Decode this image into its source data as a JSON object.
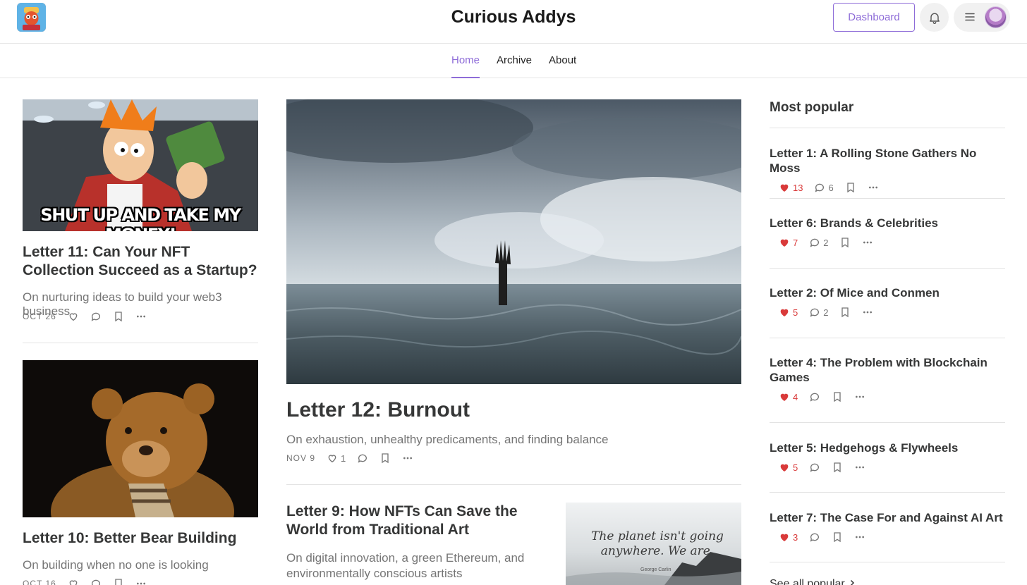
{
  "header": {
    "site_title": "Curious Addys",
    "dashboard_label": "Dashboard",
    "bell_icon": "bell-icon",
    "menu_icon": "hamburger-icon"
  },
  "nav": {
    "tabs": [
      {
        "label": "Home",
        "active": true
      },
      {
        "label": "Archive",
        "active": false
      },
      {
        "label": "About",
        "active": false
      }
    ]
  },
  "posts": {
    "letter11": {
      "image_caption": "SHUT UP AND TAKE MY MONEY!",
      "title": "Letter 11: Can Your NFT Collection Succeed as a Startup?",
      "subtitle": "On nurturing ideas to build your web3 business",
      "date": "OCT 26"
    },
    "letter10": {
      "title": "Letter 10: Better Bear Building",
      "subtitle": "On building when no one is looking",
      "date": "OCT 16"
    },
    "letter12": {
      "title": "Letter 12: Burnout",
      "subtitle": "On exhaustion, unhealthy predicaments, and finding balance",
      "date": "NOV 9",
      "likes": "1"
    },
    "letter9": {
      "title": "Letter 9: How NFTs Can Save the World from Traditional Art",
      "subtitle": "On digital innovation, a green Ethereum, and environmentally conscious artists",
      "image_quote": "The planet isn't going anywhere. We are.",
      "image_attribution": "George Carlin"
    }
  },
  "sidebar": {
    "heading": "Most popular",
    "items": [
      {
        "title": "Letter 1: A Rolling Stone Gathers No Moss",
        "likes": "13",
        "comments": "6"
      },
      {
        "title": "Letter 6: Brands & Celebrities",
        "likes": "7",
        "comments": "2"
      },
      {
        "title": "Letter 2: Of Mice and Conmen",
        "likes": "5",
        "comments": "2"
      },
      {
        "title": "Letter 4: The Problem with Blockchain Games",
        "likes": "4",
        "comments": ""
      },
      {
        "title": "Letter 5: Hedgehogs & Flywheels",
        "likes": "5",
        "comments": ""
      },
      {
        "title": "Letter 7: The Case For and Against AI Art",
        "likes": "3",
        "comments": ""
      }
    ],
    "see_all": "See all popular"
  },
  "colors": {
    "accent": "#8e6cd8",
    "like_red": "#d93a3a",
    "text": "#363737",
    "muted": "#757575"
  }
}
